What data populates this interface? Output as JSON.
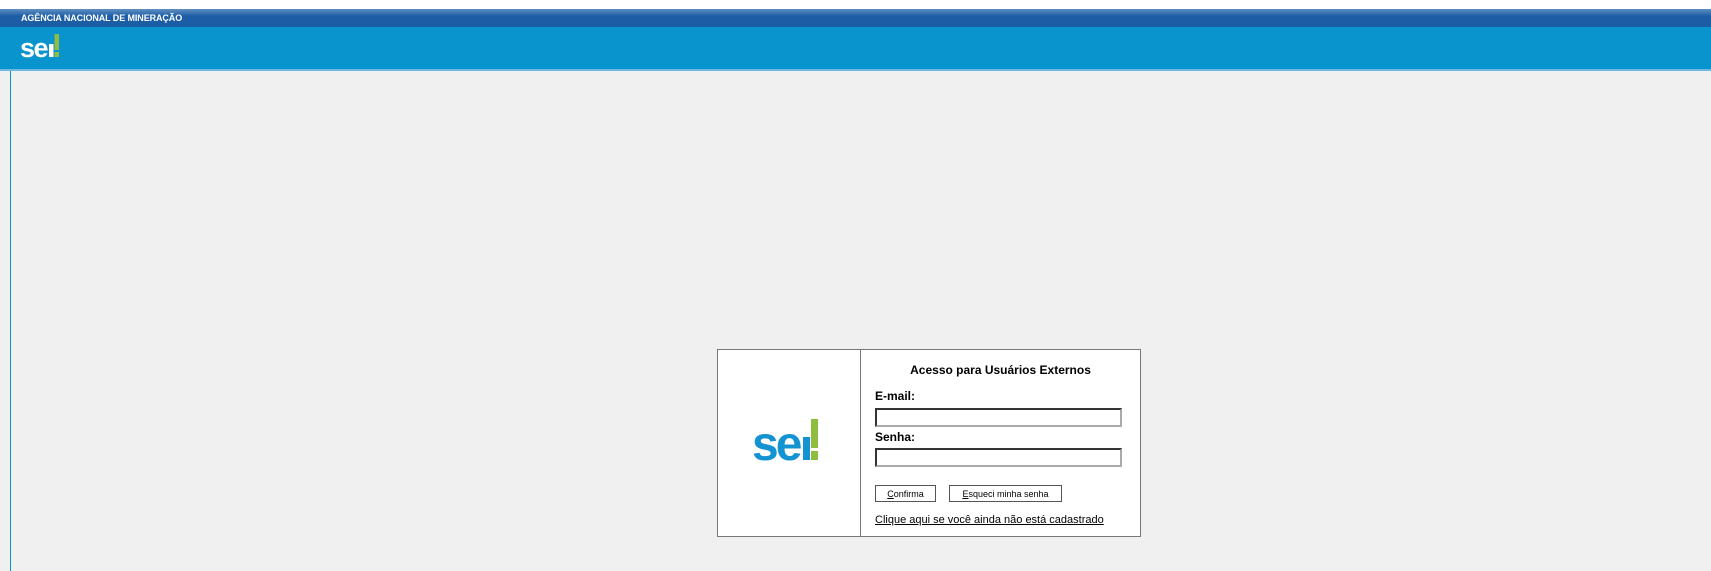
{
  "header": {
    "org_name": "AGÊNCIA NACIONAL DE MINERAÇÃO",
    "logo_icon": "sei-logo-icon"
  },
  "login": {
    "logo_icon": "sei-logo-icon",
    "title": "Acesso para Usuários Externos",
    "email_label": "E-mail:",
    "email_value": "",
    "password_label": "Senha:",
    "password_value": "",
    "confirm_button": {
      "accesskey": "C",
      "rest": "onfirma"
    },
    "forgot_button": {
      "accesskey": "E",
      "rest": "squeci minha senha"
    },
    "register_link": "Clique aqui se você ainda não está cadastrado"
  },
  "colors": {
    "org_bar": "#1c5ea6",
    "logo_bar": "#0a94ce",
    "background": "#f0f0f0",
    "logo_blue": "#1493d2",
    "logo_green": "#8fbd3f"
  }
}
